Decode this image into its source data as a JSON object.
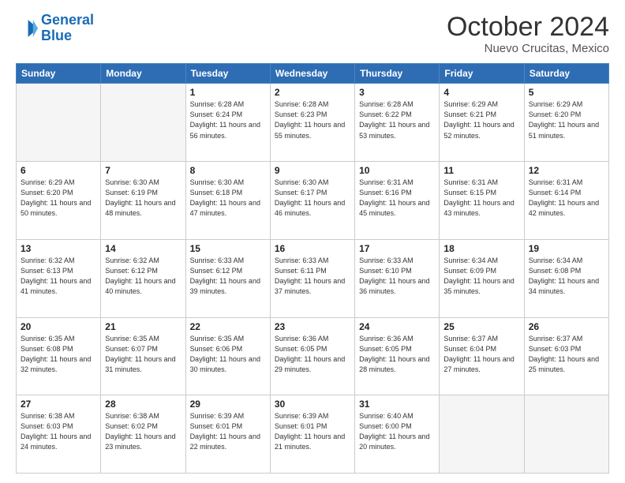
{
  "header": {
    "logo_line1": "General",
    "logo_line2": "Blue",
    "title": "October 2024",
    "subtitle": "Nuevo Crucitas, Mexico"
  },
  "weekdays": [
    "Sunday",
    "Monday",
    "Tuesday",
    "Wednesday",
    "Thursday",
    "Friday",
    "Saturday"
  ],
  "weeks": [
    [
      {
        "day": "",
        "sunrise": "",
        "sunset": "",
        "daylight": ""
      },
      {
        "day": "",
        "sunrise": "",
        "sunset": "",
        "daylight": ""
      },
      {
        "day": "1",
        "sunrise": "Sunrise: 6:28 AM",
        "sunset": "Sunset: 6:24 PM",
        "daylight": "Daylight: 11 hours and 56 minutes."
      },
      {
        "day": "2",
        "sunrise": "Sunrise: 6:28 AM",
        "sunset": "Sunset: 6:23 PM",
        "daylight": "Daylight: 11 hours and 55 minutes."
      },
      {
        "day": "3",
        "sunrise": "Sunrise: 6:28 AM",
        "sunset": "Sunset: 6:22 PM",
        "daylight": "Daylight: 11 hours and 53 minutes."
      },
      {
        "day": "4",
        "sunrise": "Sunrise: 6:29 AM",
        "sunset": "Sunset: 6:21 PM",
        "daylight": "Daylight: 11 hours and 52 minutes."
      },
      {
        "day": "5",
        "sunrise": "Sunrise: 6:29 AM",
        "sunset": "Sunset: 6:20 PM",
        "daylight": "Daylight: 11 hours and 51 minutes."
      }
    ],
    [
      {
        "day": "6",
        "sunrise": "Sunrise: 6:29 AM",
        "sunset": "Sunset: 6:20 PM",
        "daylight": "Daylight: 11 hours and 50 minutes."
      },
      {
        "day": "7",
        "sunrise": "Sunrise: 6:30 AM",
        "sunset": "Sunset: 6:19 PM",
        "daylight": "Daylight: 11 hours and 48 minutes."
      },
      {
        "day": "8",
        "sunrise": "Sunrise: 6:30 AM",
        "sunset": "Sunset: 6:18 PM",
        "daylight": "Daylight: 11 hours and 47 minutes."
      },
      {
        "day": "9",
        "sunrise": "Sunrise: 6:30 AM",
        "sunset": "Sunset: 6:17 PM",
        "daylight": "Daylight: 11 hours and 46 minutes."
      },
      {
        "day": "10",
        "sunrise": "Sunrise: 6:31 AM",
        "sunset": "Sunset: 6:16 PM",
        "daylight": "Daylight: 11 hours and 45 minutes."
      },
      {
        "day": "11",
        "sunrise": "Sunrise: 6:31 AM",
        "sunset": "Sunset: 6:15 PM",
        "daylight": "Daylight: 11 hours and 43 minutes."
      },
      {
        "day": "12",
        "sunrise": "Sunrise: 6:31 AM",
        "sunset": "Sunset: 6:14 PM",
        "daylight": "Daylight: 11 hours and 42 minutes."
      }
    ],
    [
      {
        "day": "13",
        "sunrise": "Sunrise: 6:32 AM",
        "sunset": "Sunset: 6:13 PM",
        "daylight": "Daylight: 11 hours and 41 minutes."
      },
      {
        "day": "14",
        "sunrise": "Sunrise: 6:32 AM",
        "sunset": "Sunset: 6:12 PM",
        "daylight": "Daylight: 11 hours and 40 minutes."
      },
      {
        "day": "15",
        "sunrise": "Sunrise: 6:33 AM",
        "sunset": "Sunset: 6:12 PM",
        "daylight": "Daylight: 11 hours and 39 minutes."
      },
      {
        "day": "16",
        "sunrise": "Sunrise: 6:33 AM",
        "sunset": "Sunset: 6:11 PM",
        "daylight": "Daylight: 11 hours and 37 minutes."
      },
      {
        "day": "17",
        "sunrise": "Sunrise: 6:33 AM",
        "sunset": "Sunset: 6:10 PM",
        "daylight": "Daylight: 11 hours and 36 minutes."
      },
      {
        "day": "18",
        "sunrise": "Sunrise: 6:34 AM",
        "sunset": "Sunset: 6:09 PM",
        "daylight": "Daylight: 11 hours and 35 minutes."
      },
      {
        "day": "19",
        "sunrise": "Sunrise: 6:34 AM",
        "sunset": "Sunset: 6:08 PM",
        "daylight": "Daylight: 11 hours and 34 minutes."
      }
    ],
    [
      {
        "day": "20",
        "sunrise": "Sunrise: 6:35 AM",
        "sunset": "Sunset: 6:08 PM",
        "daylight": "Daylight: 11 hours and 32 minutes."
      },
      {
        "day": "21",
        "sunrise": "Sunrise: 6:35 AM",
        "sunset": "Sunset: 6:07 PM",
        "daylight": "Daylight: 11 hours and 31 minutes."
      },
      {
        "day": "22",
        "sunrise": "Sunrise: 6:35 AM",
        "sunset": "Sunset: 6:06 PM",
        "daylight": "Daylight: 11 hours and 30 minutes."
      },
      {
        "day": "23",
        "sunrise": "Sunrise: 6:36 AM",
        "sunset": "Sunset: 6:05 PM",
        "daylight": "Daylight: 11 hours and 29 minutes."
      },
      {
        "day": "24",
        "sunrise": "Sunrise: 6:36 AM",
        "sunset": "Sunset: 6:05 PM",
        "daylight": "Daylight: 11 hours and 28 minutes."
      },
      {
        "day": "25",
        "sunrise": "Sunrise: 6:37 AM",
        "sunset": "Sunset: 6:04 PM",
        "daylight": "Daylight: 11 hours and 27 minutes."
      },
      {
        "day": "26",
        "sunrise": "Sunrise: 6:37 AM",
        "sunset": "Sunset: 6:03 PM",
        "daylight": "Daylight: 11 hours and 25 minutes."
      }
    ],
    [
      {
        "day": "27",
        "sunrise": "Sunrise: 6:38 AM",
        "sunset": "Sunset: 6:03 PM",
        "daylight": "Daylight: 11 hours and 24 minutes."
      },
      {
        "day": "28",
        "sunrise": "Sunrise: 6:38 AM",
        "sunset": "Sunset: 6:02 PM",
        "daylight": "Daylight: 11 hours and 23 minutes."
      },
      {
        "day": "29",
        "sunrise": "Sunrise: 6:39 AM",
        "sunset": "Sunset: 6:01 PM",
        "daylight": "Daylight: 11 hours and 22 minutes."
      },
      {
        "day": "30",
        "sunrise": "Sunrise: 6:39 AM",
        "sunset": "Sunset: 6:01 PM",
        "daylight": "Daylight: 11 hours and 21 minutes."
      },
      {
        "day": "31",
        "sunrise": "Sunrise: 6:40 AM",
        "sunset": "Sunset: 6:00 PM",
        "daylight": "Daylight: 11 hours and 20 minutes."
      },
      {
        "day": "",
        "sunrise": "",
        "sunset": "",
        "daylight": ""
      },
      {
        "day": "",
        "sunrise": "",
        "sunset": "",
        "daylight": ""
      }
    ]
  ]
}
